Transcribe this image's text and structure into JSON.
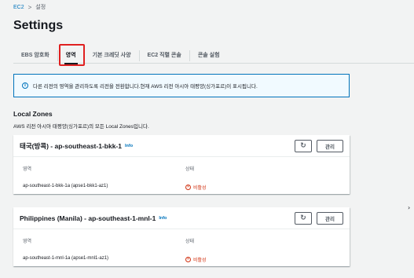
{
  "breadcrumb": {
    "root": "EC2",
    "separator": ">",
    "current": "설정"
  },
  "page_title": "Settings",
  "tabs": [
    {
      "label": "EBS 암호화",
      "active": false
    },
    {
      "label": "영역",
      "active": true
    },
    {
      "label": "기본 크레딧 사양",
      "active": false
    },
    {
      "label": "EC2 직렬 콘솔",
      "active": false
    },
    {
      "label": "콘솔 실험",
      "active": false
    }
  ],
  "alert": {
    "icon": "info-icon",
    "text": "다른 리전의 영역을 관리하도록 리전을 전환합니다.현재 AWS 리전 아시아 태평양(싱가포르)이 표시됩니다."
  },
  "local_zones": {
    "heading": "Local Zones",
    "description": "AWS 리전 아시아 태평양(싱가포르)의 모든 Local Zones입니다.",
    "zones": [
      {
        "title": "태국(방콕) - ap-southeast-1-bkk-1",
        "info": "Info",
        "refresh_icon": "refresh-icon",
        "manage_label": "관리",
        "zone_label": "영역",
        "status_label": "상태",
        "zone_value": "ap-southeast-1-bkk-1a (apse1-bkk1-az1)",
        "status_value": "비활성"
      },
      {
        "title": "Philippines (Manila) - ap-southeast-1-mnl-1",
        "info": "Info",
        "refresh_icon": "refresh-icon",
        "manage_label": "관리",
        "zone_label": "영역",
        "status_label": "상태",
        "zone_value": "ap-southeast-1-mnl-1a (apse1-mnl1-az1)",
        "status_value": "비활성"
      }
    ]
  },
  "colors": {
    "accent": "#0073bb",
    "inactive": "#d13212",
    "highlight_box": "#e02020"
  }
}
